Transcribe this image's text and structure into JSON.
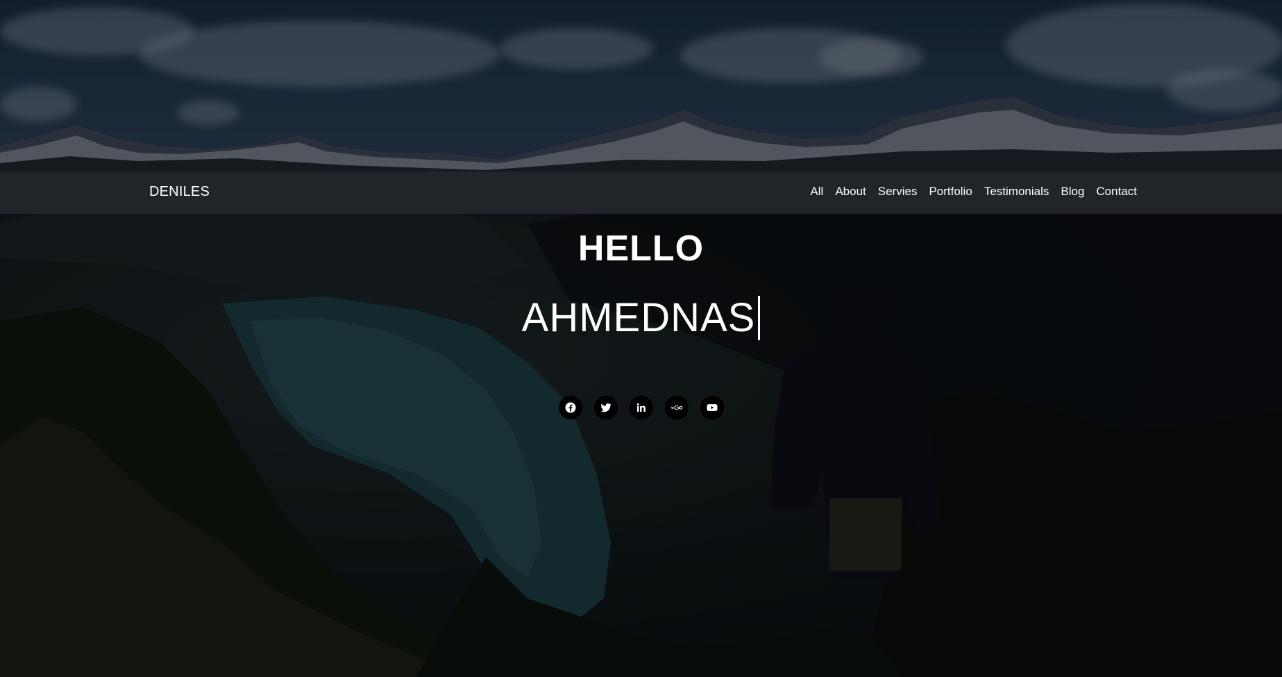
{
  "navbar": {
    "brand": "DENILES",
    "links": [
      {
        "label": "All"
      },
      {
        "label": "About"
      },
      {
        "label": "Servies"
      },
      {
        "label": "Portfolio"
      },
      {
        "label": "Testimonials"
      },
      {
        "label": "Blog"
      },
      {
        "label": "Contact"
      }
    ]
  },
  "hero": {
    "greeting": "HELLO",
    "typed_text": "AHMEDNAS"
  },
  "socials": [
    {
      "icon": "facebook-icon"
    },
    {
      "icon": "twitter-icon"
    },
    {
      "icon": "linkedin-icon"
    },
    {
      "icon": "go-icon"
    },
    {
      "icon": "youtube-icon"
    }
  ],
  "colors": {
    "navbar_bg": "#212529",
    "text": "#ffffff",
    "social_bg": "#000000"
  }
}
